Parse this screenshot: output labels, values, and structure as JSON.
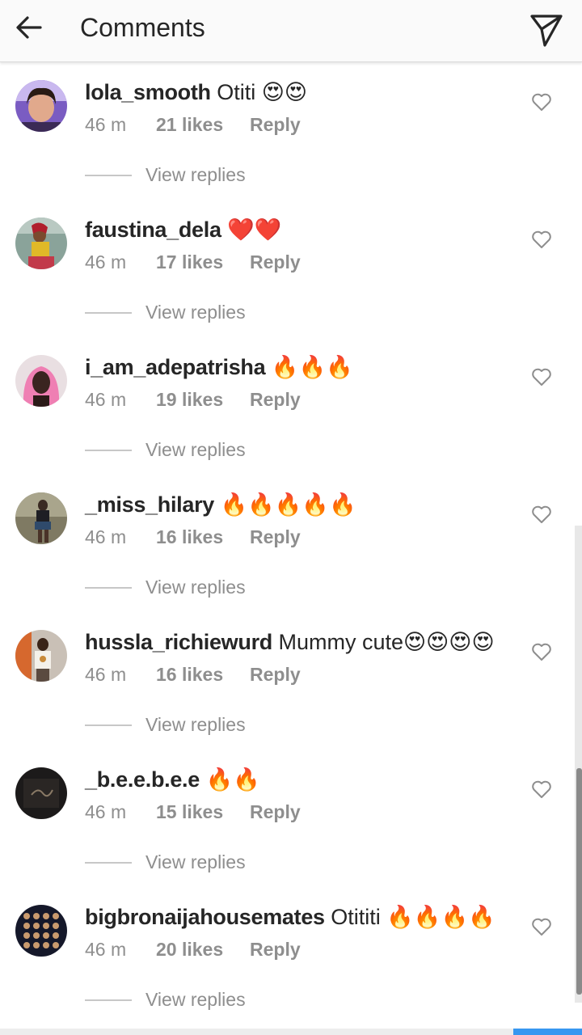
{
  "header": {
    "title": "Comments",
    "back_icon": "arrow-left-icon",
    "send_icon": "paper-plane-icon"
  },
  "colors": {
    "text_primary": "#262626",
    "text_secondary": "#8e8e8e",
    "accent": "#3897f0"
  },
  "comments": [
    {
      "username": "lola_smooth",
      "text": " Otiti 😍😍",
      "time": "46 m",
      "likes": "21 likes",
      "reply": "Reply",
      "view_replies": "View replies"
    },
    {
      "username": "faustina_dela",
      "text": " ❤️❤️",
      "time": "46 m",
      "likes": "17 likes",
      "reply": "Reply",
      "view_replies": "View replies"
    },
    {
      "username": "i_am_adepatrisha",
      "text": " 🔥🔥🔥",
      "time": "46 m",
      "likes": "19 likes",
      "reply": "Reply",
      "view_replies": "View replies"
    },
    {
      "username": "_miss_hilary",
      "text": " 🔥🔥🔥🔥🔥",
      "time": "46 m",
      "likes": "16 likes",
      "reply": "Reply",
      "view_replies": "View replies"
    },
    {
      "username": "hussla_richiewurd",
      "text": " Mummy cute😍😍😍😍",
      "time": "46 m",
      "likes": "16 likes",
      "reply": "Reply",
      "view_replies": "View replies"
    },
    {
      "username": "_b.e.e.b.e.e",
      "text": " 🔥🔥",
      "time": "46 m",
      "likes": "15 likes",
      "reply": "Reply",
      "view_replies": "View replies"
    },
    {
      "username": "bigbronaijahousemates",
      "text": " Otititi 🔥🔥🔥🔥",
      "time": "46 m",
      "likes": "20 likes",
      "reply": "Reply",
      "view_replies": "View replies"
    }
  ]
}
